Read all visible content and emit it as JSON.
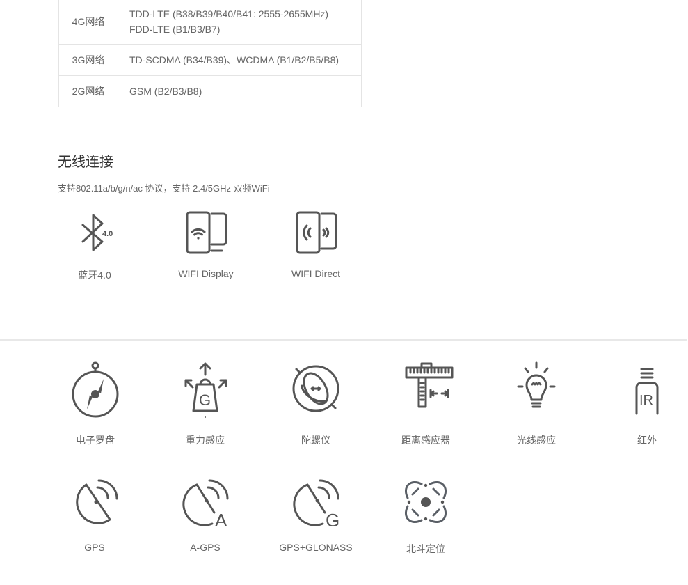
{
  "network_table": {
    "rows": [
      {
        "label": "4G网络",
        "lines": [
          "TDD-LTE (B38/B39/B40/B41: 2555-2655MHz)",
          "FDD-LTE (B1/B3/B7)"
        ]
      },
      {
        "label": "3G网络",
        "lines": [
          "TD-SCDMA (B34/B39)、WCDMA (B1/B2/B5/B8)"
        ]
      },
      {
        "label": "2G网络",
        "lines": [
          "GSM (B2/B3/B8)"
        ]
      }
    ]
  },
  "wireless": {
    "title": "无线连接",
    "description": "支持802.11a/b/g/n/ac 协议，支持 2.4/5GHz 双频WiFi",
    "features": [
      {
        "icon": "bluetooth-icon",
        "badge": "4.0",
        "label": "蓝牙4.0"
      },
      {
        "icon": "wifi-display-icon",
        "label": "WIFI Display"
      },
      {
        "icon": "wifi-direct-icon",
        "label": "WIFI Direct"
      }
    ]
  },
  "sensors": {
    "row1": [
      {
        "icon": "compass-icon",
        "label": "电子罗盘"
      },
      {
        "icon": "gravity-icon",
        "glyph": "G",
        "label": "重力感应"
      },
      {
        "icon": "gyroscope-icon",
        "label": "陀螺仪"
      },
      {
        "icon": "ruler-icon",
        "label": "距离感应器"
      },
      {
        "icon": "light-bulb-icon",
        "label": "光线感应"
      },
      {
        "icon": "infrared-icon",
        "glyph": "IR",
        "label": "红外"
      }
    ],
    "row2": [
      {
        "icon": "gps-dish-icon",
        "label": "GPS"
      },
      {
        "icon": "agps-dish-icon",
        "glyph": "A",
        "label": "A-GPS"
      },
      {
        "icon": "glonass-dish-icon",
        "glyph": "G",
        "label": "GPS+GLONASS"
      },
      {
        "icon": "beidou-icon",
        "label": "北斗定位"
      }
    ]
  }
}
